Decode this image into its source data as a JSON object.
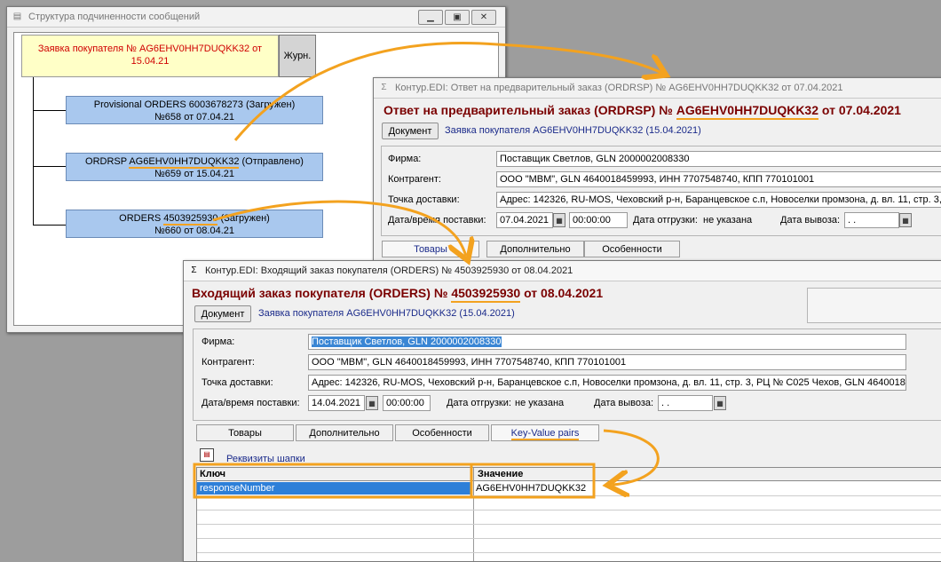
{
  "tree_window": {
    "title": "Структура подчиненности сообщений",
    "root": {
      "line1": "Заявка покупателя № AG6EHV0HH7DUQKK32 от",
      "line2": "15.04.21"
    },
    "journal_button": "Журн.",
    "nodes": [
      {
        "line1_a": "Provisional ORDERS 6003678273 (Загружен)",
        "line1_num": "",
        "line1_b": "",
        "line2": "№658 от 07.04.21"
      },
      {
        "line1_a": "ORDRSP ",
        "line1_num": "AG6EHV0HH7DUQKK32",
        "line1_b": " (Отправлено)",
        "line2": "№659 от 15.04.21"
      },
      {
        "line1_a": "ORDERS ",
        "line1_num": "4503925930",
        "line1_b": " (Загружен)",
        "line2": "№660 от 08.04.21"
      }
    ]
  },
  "ordrsp_window": {
    "title": "Контур.EDI: Ответ на предварительный заказ (ORDRSP) № AG6EHV0HH7DUQKK32 от  07.04.2021",
    "heading_a": "Ответ на предварительный заказ (ORDRSP) № ",
    "heading_num": "AG6EHV0HH7DUQKK32",
    "heading_b": " от 07.04.2021",
    "document_button": "Документ",
    "link": "Заявка покупателя AG6EHV0HH7DUQKK32 (15.04.2021)",
    "firm_label": "Фирма:",
    "firm_value": "Поставщик Светлов, GLN 2000002008330",
    "counterparty_label": "Контрагент:",
    "counterparty_value": "ООО \"МВМ\", GLN 4640018459993, ИНН 7707548740, КПП 770101001",
    "delivery_label": "Точка доставки:",
    "delivery_value": "Адрес: 142326, RU-MOS, Чеховский р-н, Баранцевское с.п, Новоселки промзона, д. вл. 11, стр. 3,",
    "datetime_label": "Дата/время поставки:",
    "date_value": "07.04.2021",
    "time_value": "00:00:00",
    "shipment_label": "Дата отгрузки:",
    "shipment_value": "не указана",
    "export_label": "Дата вывоза:",
    "export_value": " .  .",
    "tabs": [
      "Товары",
      "Дополнительно",
      "Особенности"
    ]
  },
  "orders_window": {
    "title": "Контур.EDI: Входящий заказ покупателя (ORDERS) № 4503925930 от 08.04.2021",
    "heading_a": "Входящий заказ покупателя (ORDERS) № ",
    "heading_num": "4503925930",
    "heading_b": " от 08.04.2021",
    "document_button": "Документ",
    "link": "Заявка покупателя AG6EHV0HH7DUQKK32 (15.04.2021)",
    "firm_label": "Фирма:",
    "firm_value": "Поставщик Светлов, GLN 2000002008330",
    "counterparty_label": "Контрагент:",
    "counterparty_value": "ООО \"МВМ\", GLN 4640018459993, ИНН 7707548740, КПП 770101001",
    "delivery_label": "Точка доставки:",
    "delivery_value": "Адрес: 142326, RU-MOS, Чеховский р-н, Баранцевское с.п, Новоселки промзона, д. вл. 11, стр. 3, РЦ № С025 Чехов, GLN 4640018",
    "datetime_label": "Дата/время поставки:",
    "date_value": "14.04.2021",
    "time_value": "00:00:00",
    "shipment_label": "Дата отгрузки:",
    "shipment_value": "не указана",
    "export_label": "Дата вывоза:",
    "export_value": " .  .",
    "tabs": [
      "Товары",
      "Дополнительно",
      "Особенности",
      "Key-Value pairs"
    ],
    "subsection_link": "Реквизиты шапки",
    "grid": {
      "col_key": "Ключ",
      "col_value": "Значение",
      "rows": [
        {
          "key": "responseNumber",
          "value": "AG6EHV0HH7DUQKK32"
        }
      ]
    }
  },
  "colors": {
    "accent_orange": "#f3a21f",
    "node_blue": "#a9c8ee",
    "root_yellow": "#ffffc7",
    "heading_red": "#7a0000"
  }
}
